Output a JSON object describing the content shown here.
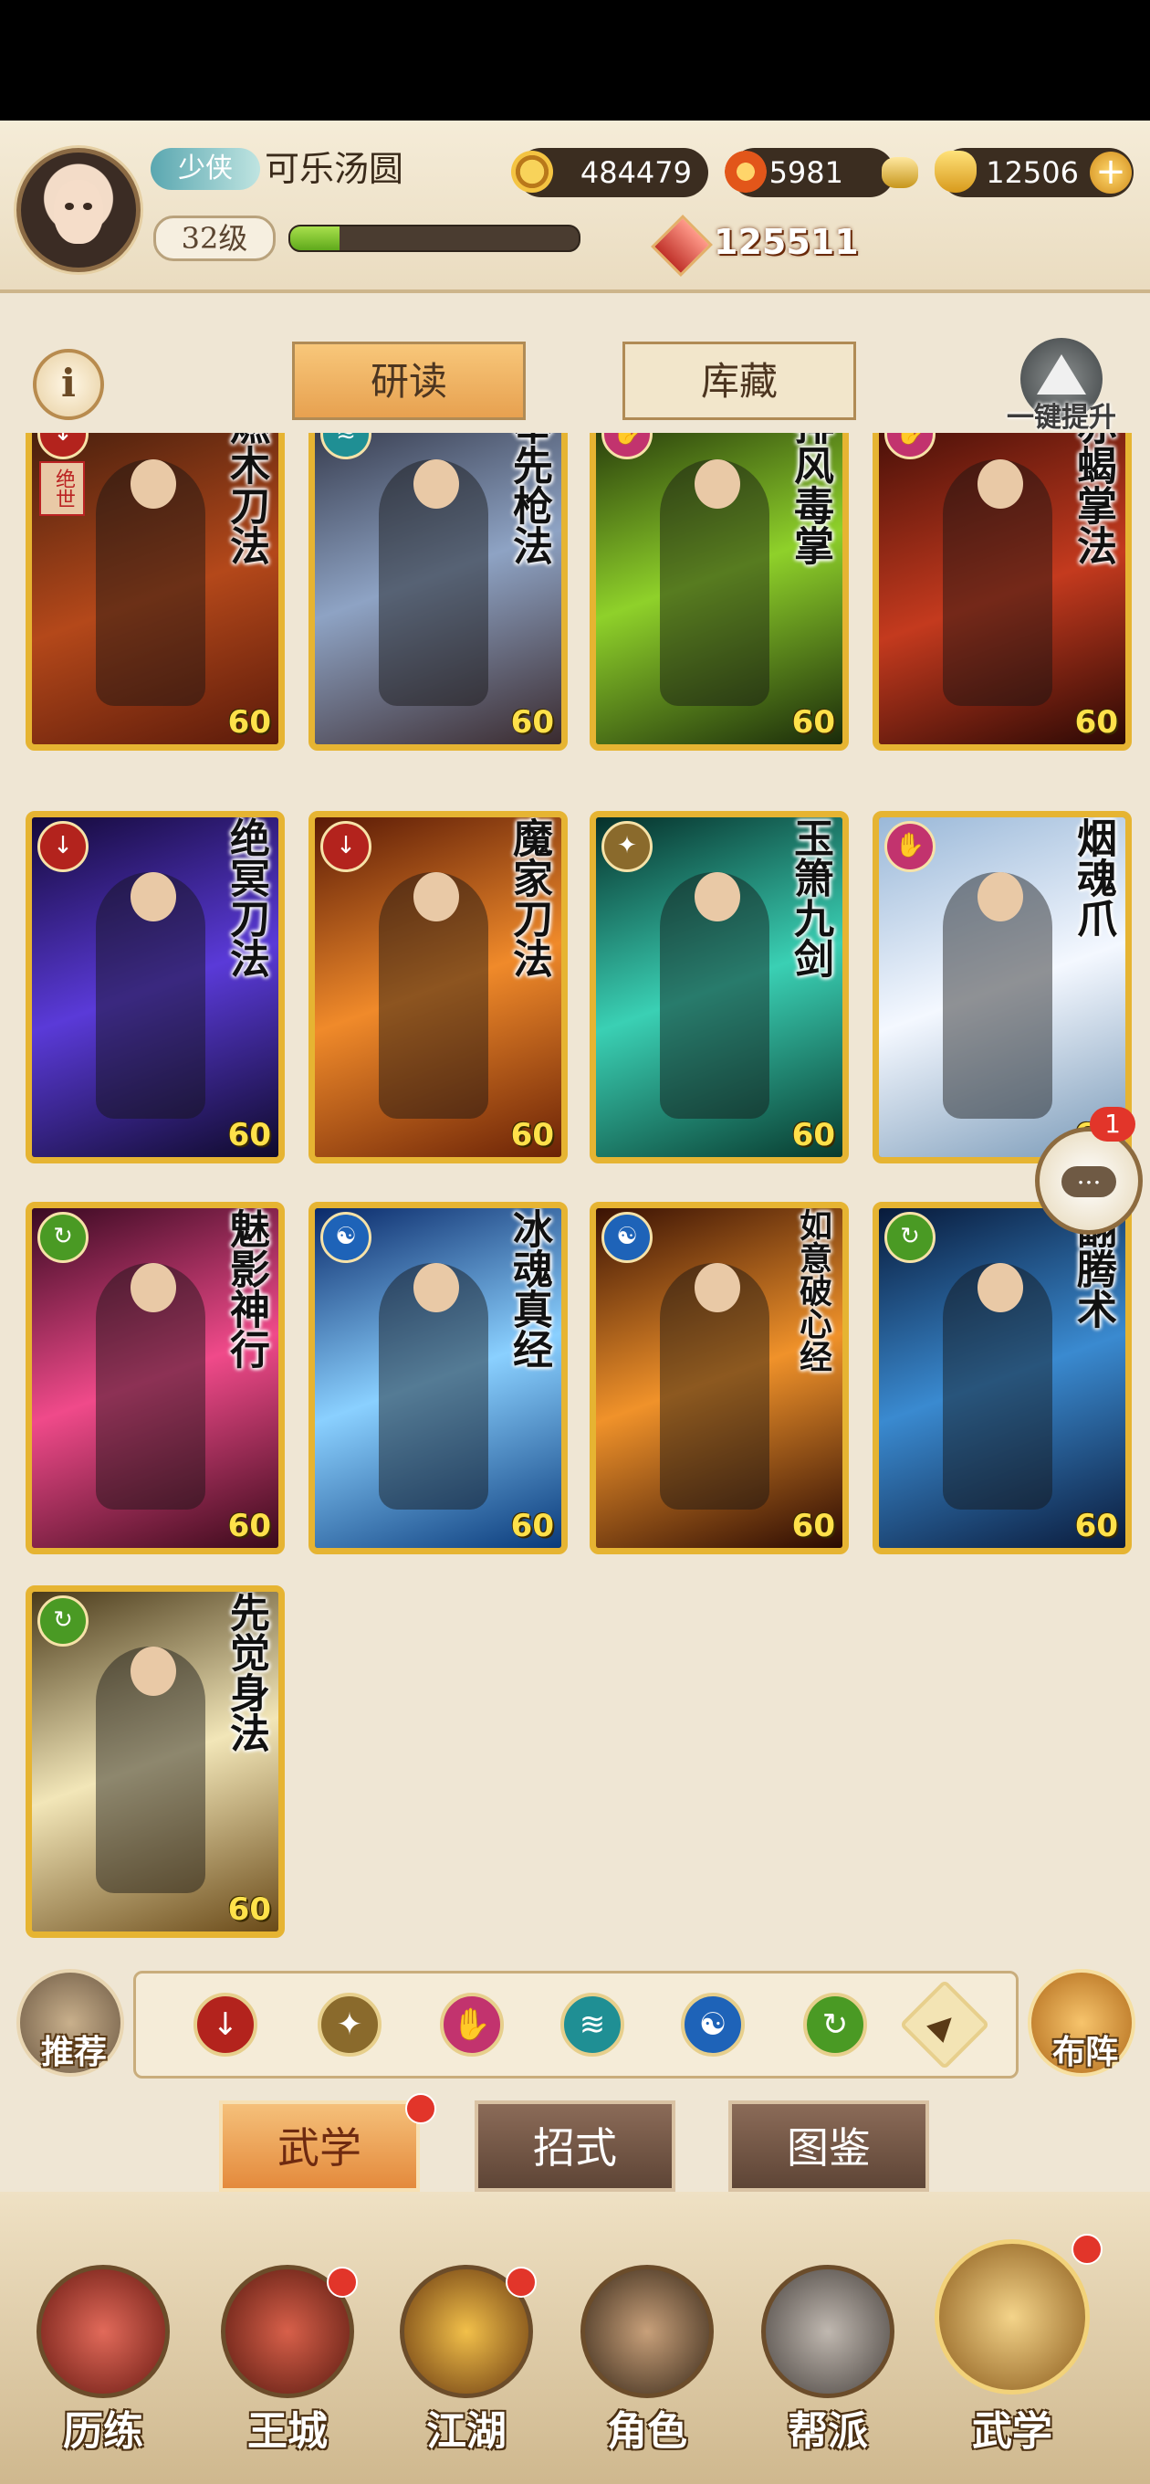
{
  "player": {
    "title": "少侠",
    "name": "可乐汤圆",
    "level": "32级",
    "xp_fraction": 0.17
  },
  "resources": {
    "coins": "484479",
    "flames": "5981",
    "ingots": "12506",
    "power": "125511"
  },
  "toolbar": {
    "info_label": "i",
    "tab_study": "研读",
    "tab_storage": "库藏",
    "upgrade_label": "一键提升"
  },
  "cards": [
    {
      "name": "燃木刀法",
      "level": "60",
      "type": "blade",
      "rarity": "绝世"
    },
    {
      "name": "奉先枪法",
      "level": "60",
      "type": "fan",
      "rarity": ""
    },
    {
      "name": "排风毒掌",
      "level": "60",
      "type": "palm",
      "rarity": ""
    },
    {
      "name": "赤蝎掌法",
      "level": "60",
      "type": "palm",
      "rarity": ""
    },
    {
      "name": "绝冥刀法",
      "level": "60",
      "type": "blade",
      "rarity": ""
    },
    {
      "name": "魔家刀法",
      "level": "60",
      "type": "blade",
      "rarity": ""
    },
    {
      "name": "玉箫九剑",
      "level": "60",
      "type": "sword",
      "rarity": ""
    },
    {
      "name": "烟魂爪",
      "level": "60",
      "type": "palm",
      "rarity": ""
    },
    {
      "name": "魅影神行",
      "level": "60",
      "type": "movement",
      "rarity": ""
    },
    {
      "name": "冰魂真经",
      "level": "60",
      "type": "inner",
      "rarity": ""
    },
    {
      "name": "如意破心经",
      "level": "60",
      "type": "inner",
      "rarity": ""
    },
    {
      "name": "翻腾术",
      "level": "60",
      "type": "movement",
      "rarity": ""
    },
    {
      "name": "先觉身法",
      "level": "60",
      "type": "movement",
      "rarity": ""
    }
  ],
  "chat": {
    "unread": "1"
  },
  "filters": {
    "recommend_label": "推荐",
    "formation_label": "布阵",
    "icons": [
      "blade-icon",
      "sword-icon",
      "palm-icon",
      "fan-icon",
      "inner-icon",
      "movement-icon",
      "all-icon"
    ]
  },
  "subtabs": {
    "martial": "武学",
    "moves": "招式",
    "atlas": "图鉴"
  },
  "nav": {
    "items": [
      "历练",
      "王城",
      "江湖",
      "角色",
      "帮派",
      "武学"
    ]
  },
  "colors": {
    "blade": "#b3231d",
    "sword": "#8a6a2c",
    "palm": "#c2336e",
    "fan": "#1f8f94",
    "inner": "#1e63b8",
    "movement": "#4a9a24",
    "card_border": "#e6b432"
  }
}
